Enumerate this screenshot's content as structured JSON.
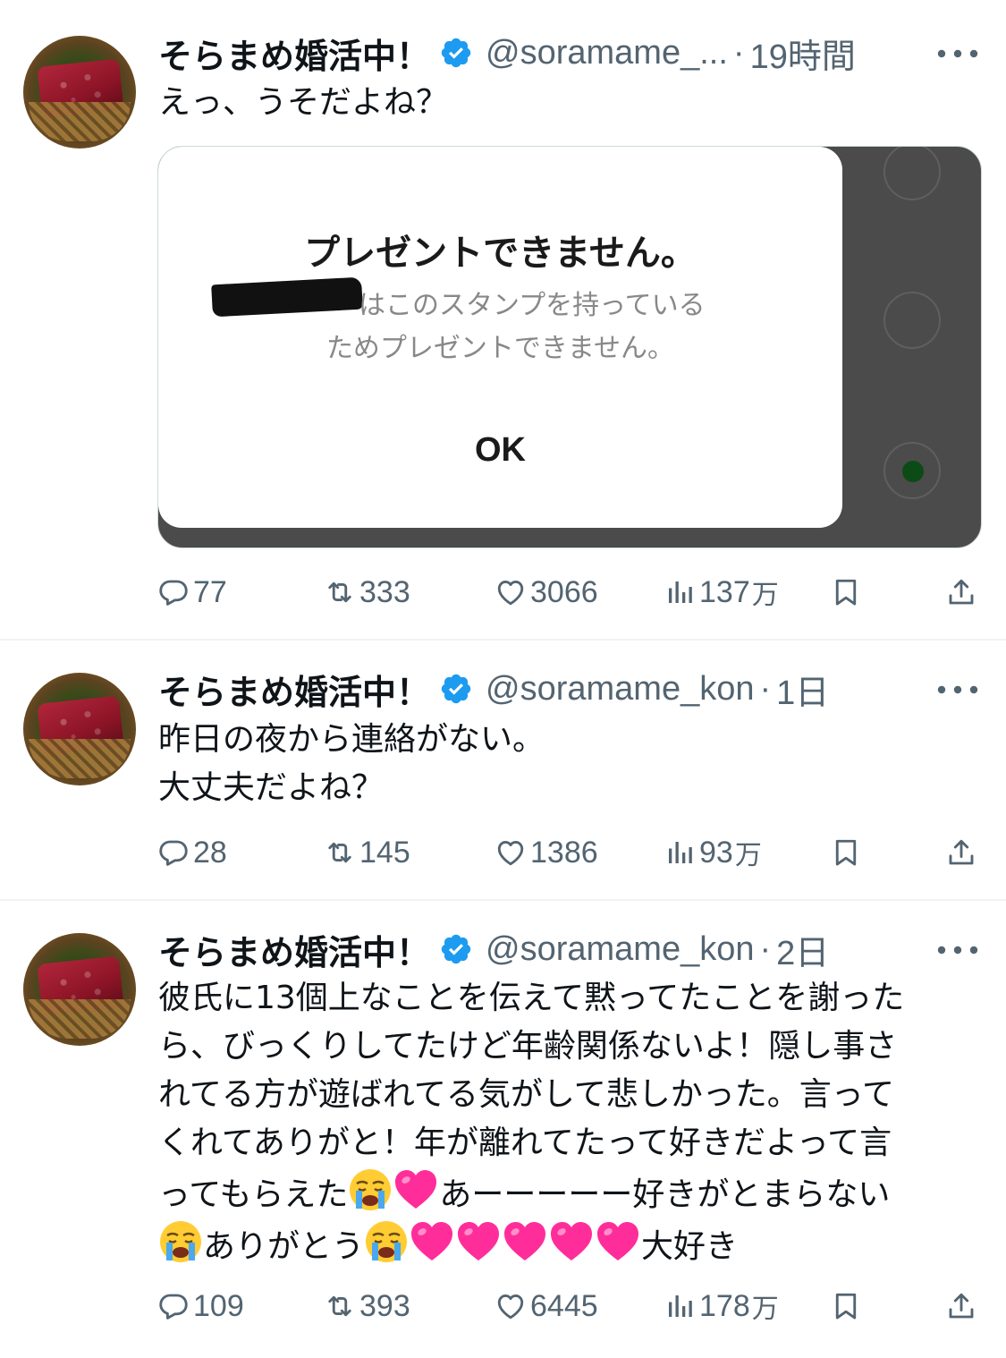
{
  "colors": {
    "verified": "#1d9bf0",
    "text": "#0f1419",
    "muted": "#536471",
    "heart_emoji": "#ff2d9a"
  },
  "tweets": [
    {
      "name": "そらまめ婚活中！",
      "handle": "@soramame_...",
      "sep": "·",
      "time": "19時間",
      "lines": [
        "えっ、うそだよね？"
      ],
      "media": {
        "title": "プレゼントできません。",
        "line1": "はこのスタンプを持っている",
        "line2": "ためプレゼントできません。",
        "ok": "OK"
      },
      "stats": {
        "replies": "77",
        "retweets": "333",
        "likes": "3066",
        "views": "137",
        "views_unit": "万"
      }
    },
    {
      "name": "そらまめ婚活中！",
      "handle": "@soramame_kon",
      "sep": "·",
      "time": "1日",
      "lines": [
        "昨日の夜から連絡がない。",
        "大丈夫だよね？"
      ],
      "stats": {
        "replies": "28",
        "retweets": "145",
        "likes": "1386",
        "views": "93",
        "views_unit": "万"
      }
    },
    {
      "name": "そらまめ婚活中！",
      "handle": "@soramame_kon",
      "sep": "·",
      "time": "2日",
      "lines": [
        "彼氏に13個上なことを伝えて黙ってたことを謝った",
        "ら、びっくりしてたけど年齢関係ないよ！隠し事さ",
        "れてる方が遊ばれてる気がして悲しかった。言って",
        "くれてありがと！年が離れてたって好きだよって言",
        "ってもらえた",
        "あーーーーー好きがとまらない",
        "ありがとう",
        "大好き"
      ],
      "stats": {
        "replies": "109",
        "retweets": "393",
        "likes": "6445",
        "views": "178",
        "views_unit": "万"
      }
    }
  ]
}
